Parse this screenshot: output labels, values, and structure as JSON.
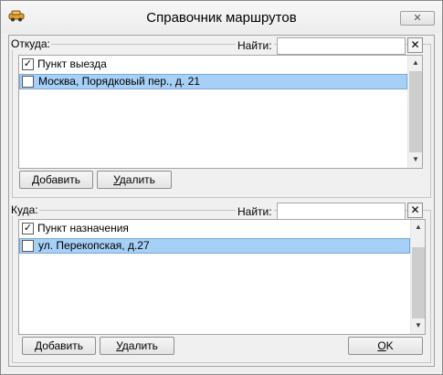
{
  "window": {
    "title": "Справочник маршрутов",
    "close_glyph": "✕"
  },
  "from_section": {
    "label": "Откуда:",
    "find_label": "Найти:",
    "search_value": "",
    "clear_glyph": "✕",
    "list": {
      "header": {
        "label": "Пункт выезда",
        "checked": true
      },
      "items": [
        {
          "label": "Москва, Порядковый пер., д. 21",
          "checked": false,
          "selected": true
        }
      ]
    },
    "add_button": {
      "mnemonic": "Д",
      "rest": "обавить"
    },
    "delete_button": {
      "mnemonic": "У",
      "rest": "далить"
    }
  },
  "to_section": {
    "label": "Куда:",
    "find_label": "Найти:",
    "search_value": "",
    "clear_glyph": "✕",
    "list": {
      "header": {
        "label": "Пункт назначения",
        "checked": true
      },
      "items": [
        {
          "label": "ул. Перекопская,  д.27",
          "checked": false,
          "selected": true
        }
      ]
    },
    "add_button": {
      "mnemonic": "Д",
      "rest": "обавить"
    },
    "delete_button": {
      "mnemonic": "У",
      "rest": "далить"
    }
  },
  "ok_button": {
    "mnemonic": "O",
    "rest": "K"
  },
  "glyphs": {
    "check": "✓",
    "up": "▲",
    "down": "▼"
  }
}
